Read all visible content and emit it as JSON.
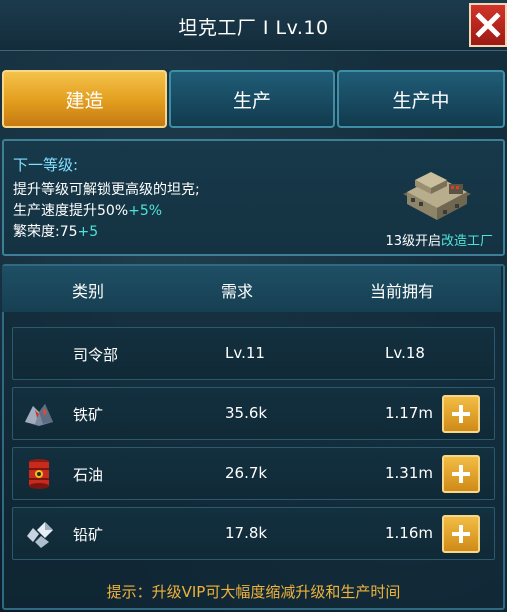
{
  "header": {
    "title": "坦克工厂 I  Lv.10"
  },
  "tabs": [
    {
      "label": "建造",
      "active": true
    },
    {
      "label": "生产",
      "active": false
    },
    {
      "label": "生产中",
      "active": false
    }
  ],
  "info": {
    "heading": "下一等级:",
    "line1": "提升等级可解锁更高级的坦克;",
    "line2_prefix": "生产速度提升50%",
    "line2_bonus": "+5%",
    "line3_prefix": "繁荣度:75",
    "line3_bonus": "+5",
    "unlock_prefix": "13级开启",
    "unlock_link": "改造工厂"
  },
  "table": {
    "headers": {
      "category": "类别",
      "required": "需求",
      "owned": "当前拥有"
    },
    "rows": [
      {
        "icon": "command-hq",
        "name": "司令部",
        "required": "Lv.11",
        "owned": "Lv.18",
        "has_plus": false
      },
      {
        "icon": "iron-ore-icon",
        "name": "铁矿",
        "required": "35.6k",
        "owned": "1.17m",
        "has_plus": true
      },
      {
        "icon": "oil-barrel-icon",
        "name": "石油",
        "required": "26.7k",
        "owned": "1.31m",
        "has_plus": true
      },
      {
        "icon": "lead-ore-icon",
        "name": "铅矿",
        "required": "17.8k",
        "owned": "1.16m",
        "has_plus": true
      }
    ]
  },
  "hint": "提示：升级VIP可大幅度缩减升级和生产时间",
  "colors": {
    "accent_gold": "#e29d1e",
    "bonus_cyan": "#4fe3d8",
    "close_red": "#c22a22"
  }
}
